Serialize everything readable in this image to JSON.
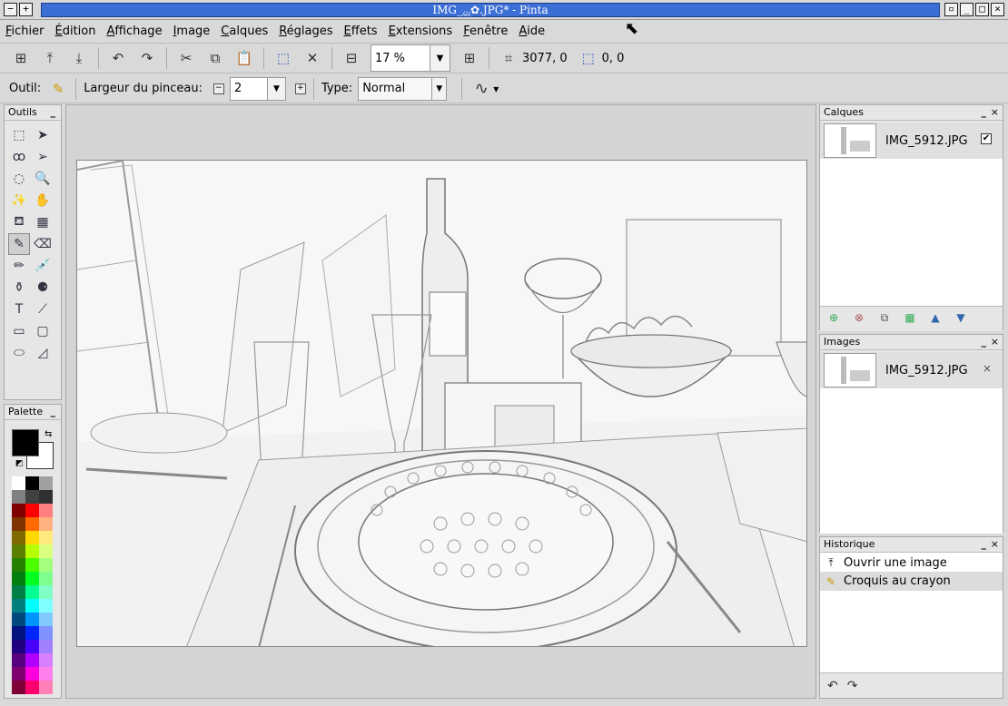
{
  "window": {
    "title": "IMG_⁁⁁⁁✿.JPG* - Pinta",
    "left_buttons": [
      "−",
      "+"
    ],
    "right_buttons": [
      "▫",
      "_",
      "□",
      "×"
    ]
  },
  "menu": [
    "Fichier",
    "Édition",
    "Affichage",
    "Image",
    "Calques",
    "Réglages",
    "Effets",
    "Extensions",
    "Fenêtre",
    "Aide"
  ],
  "toolbar": {
    "new_icon": "⊞",
    "open_icon": "⤒",
    "save_icon": "⤓",
    "undo_icon": "↶",
    "redo_icon": "↷",
    "cut_icon": "✂",
    "copy_icon": "⧉",
    "paste_icon": "📋",
    "crop_icon": "⬚",
    "deselect_icon": "✕",
    "zoom_out_icon": "⊟",
    "zoom_value": "17 %",
    "zoom_dropdown": "▼",
    "zoom_in_icon": "⊞",
    "cursor_pos_icon": "⌗",
    "cursor_pos": "3077, 0",
    "selection_icon": "⬚",
    "selection_size": "0, 0"
  },
  "options": {
    "tool_label": "Outil:",
    "tool_icon": "✎",
    "brush_width_label": "Largeur du pinceau:",
    "brush_width_minus": "−",
    "brush_width_value": "2",
    "brush_width_dropdown": "▼",
    "brush_width_plus": "+",
    "type_label": "Type:",
    "type_value": "Normal",
    "type_dropdown": "▼",
    "antialias_icon": "∿",
    "antialias_dropdown": "▾"
  },
  "tools_panel": {
    "title": "Outils",
    "collapse": "_",
    "tools": [
      {
        "icon": "⬚",
        "name": "rectangle-select-tool-icon"
      },
      {
        "icon": "➤",
        "name": "move-selected-tool-icon"
      },
      {
        "icon": "ꝏ",
        "name": "lasso-select-tool-icon"
      },
      {
        "icon": "➢",
        "name": "move-selection-tool-icon"
      },
      {
        "icon": "◌",
        "name": "ellipse-select-tool-icon"
      },
      {
        "icon": "🔍",
        "name": "zoom-tool-icon"
      },
      {
        "icon": "✨",
        "name": "magic-wand-tool-icon"
      },
      {
        "icon": "✋",
        "name": "pan-tool-icon"
      },
      {
        "icon": "⛾",
        "name": "paint-bucket-tool-icon"
      },
      {
        "icon": "▦",
        "name": "gradient-tool-icon"
      },
      {
        "icon": "✎",
        "name": "paintbrush-tool-icon"
      },
      {
        "icon": "⌫",
        "name": "eraser-tool-icon"
      },
      {
        "icon": "✏",
        "name": "pencil-tool-icon"
      },
      {
        "icon": "💉",
        "name": "color-picker-tool-icon"
      },
      {
        "icon": "⚱",
        "name": "clone-stamp-tool-icon"
      },
      {
        "icon": "⚈",
        "name": "recolor-tool-icon"
      },
      {
        "icon": "T",
        "name": "text-tool-icon"
      },
      {
        "icon": "⟋",
        "name": "line-curve-tool-icon"
      },
      {
        "icon": "▭",
        "name": "rectangle-tool-icon"
      },
      {
        "icon": "▢",
        "name": "rounded-rectangle-tool-icon"
      },
      {
        "icon": "⬭",
        "name": "ellipse-tool-icon"
      },
      {
        "icon": "◿",
        "name": "freeform-shape-tool-icon"
      }
    ]
  },
  "palette_panel": {
    "title": "Palette",
    "collapse": "_",
    "swap_icon": "⇆",
    "reset_icon": "◩",
    "primary": "#000000",
    "secondary": "#ffffff",
    "colors": [
      "#ffffff",
      "#000000",
      "#a0a0a0",
      "#808080",
      "#404040",
      "#303030",
      "#7f0000",
      "#ff0000",
      "#ff7f7f",
      "#7f3300",
      "#ff6a00",
      "#ffb27f",
      "#7f6a00",
      "#ffd800",
      "#ffe97f",
      "#5b7f00",
      "#b6ff00",
      "#daff7f",
      "#267f00",
      "#4cff00",
      "#a5ff7f",
      "#007f0e",
      "#00ff21",
      "#7fff8e",
      "#007f46",
      "#00ff90",
      "#7fffc5",
      "#007f7f",
      "#00ffff",
      "#7fffff",
      "#00497f",
      "#0094ff",
      "#7fc9ff",
      "#00137f",
      "#0026ff",
      "#7f92ff",
      "#21007f",
      "#4800ff",
      "#a17fff",
      "#57007f",
      "#b200ff",
      "#d67fff",
      "#7f006e",
      "#ff00dc",
      "#ff7fed",
      "#7f0037",
      "#ff006e",
      "#ff7fb6"
    ]
  },
  "layers_panel": {
    "title": "Calques",
    "collapse": "_",
    "close": "×",
    "layer_name": "IMG_5912.JPG",
    "visible_check": "✔",
    "tools": [
      "⊕",
      "⊗",
      "⧉",
      "▦",
      "▲",
      "▼"
    ]
  },
  "images_panel": {
    "title": "Images",
    "collapse": "_",
    "close": "×",
    "image_name": "IMG_5912.JPG",
    "remove": "×"
  },
  "history_panel": {
    "title": "Historique",
    "collapse": "_",
    "close": "×",
    "items": [
      {
        "icon": "⤒",
        "label": "Ouvrir une image"
      },
      {
        "icon": "✎",
        "label": "Croquis au crayon"
      }
    ],
    "undo_icon": "↶",
    "redo_icon": "↷"
  }
}
